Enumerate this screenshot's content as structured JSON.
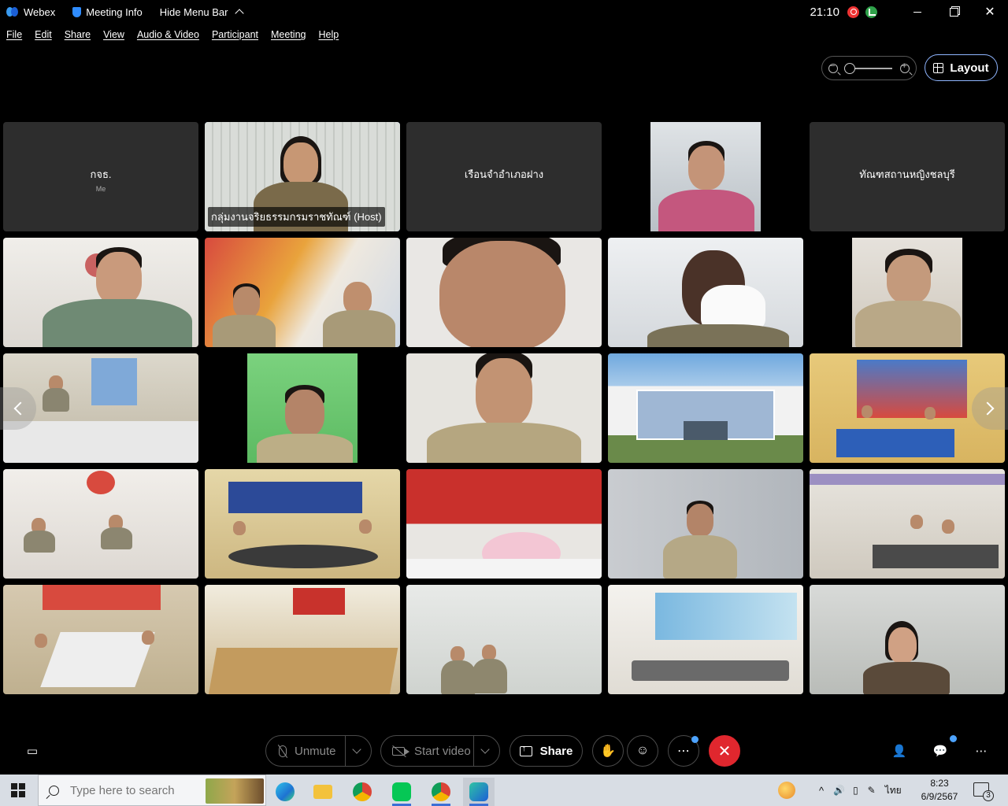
{
  "titlebar": {
    "app_name": "Webex",
    "meeting_info": "Meeting Info",
    "hide_menu": "Hide Menu Bar",
    "time": "21:10"
  },
  "menu": [
    "File",
    "Edit",
    "Share",
    "View",
    "Audio & Video",
    "Participant",
    "Meeting",
    "Help"
  ],
  "layout_label": "Layout",
  "tiles": [
    {
      "type": "name",
      "name": "กจธ.",
      "sub": "Me"
    },
    {
      "type": "video",
      "label": "กลุ่มงานจริยธรรมกรมราชทัณฑ์ (Host)",
      "host": true
    },
    {
      "type": "name",
      "name": "เรือนจำอำเภอฝาง"
    },
    {
      "type": "video"
    },
    {
      "type": "name",
      "name": "ทัณฑสถานหญิงชลบุรี"
    }
  ],
  "controls": {
    "unmute": "Unmute",
    "start_video": "Start video",
    "share": "Share"
  },
  "taskbar": {
    "search_placeholder": "Type here to search",
    "lang": "ไทย",
    "time": "8:23",
    "date": "6/9/2567",
    "notifications": "3"
  },
  "colors": {
    "accent": "#7fb5ff",
    "end_call": "#e0272e",
    "tile_bg": "#2d2d2d"
  }
}
